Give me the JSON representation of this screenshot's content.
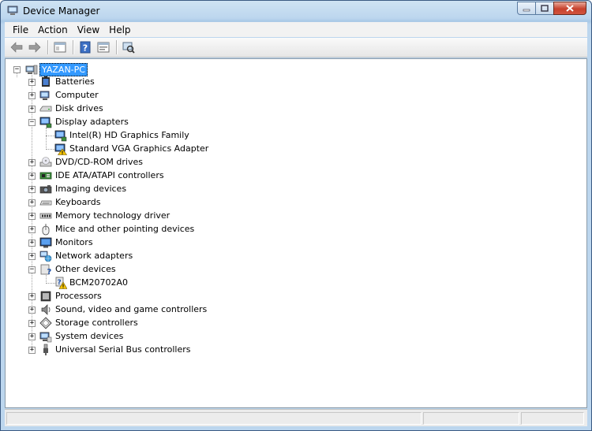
{
  "window": {
    "title": "Device Manager",
    "controls": [
      "minimize",
      "maximize",
      "close"
    ]
  },
  "menu": {
    "items": [
      "File",
      "Action",
      "View",
      "Help"
    ]
  },
  "toolbar": {
    "buttons": [
      "back-icon",
      "forward-icon",
      "show-hide-console-tree-icon",
      "help-icon",
      "properties-icon",
      "scan-hardware-icon"
    ]
  },
  "tree": {
    "root": "YAZAN-PC",
    "categories": [
      {
        "label": "Batteries",
        "icon": "battery-icon",
        "expanded": false
      },
      {
        "label": "Computer",
        "icon": "computer-icon",
        "expanded": false
      },
      {
        "label": "Disk drives",
        "icon": "disk-drive-icon",
        "expanded": false
      },
      {
        "label": "Display adapters",
        "icon": "display-adapter-icon",
        "expanded": true,
        "children": [
          {
            "label": "Intel(R) HD Graphics Family",
            "icon": "display-adapter-icon",
            "warning": false
          },
          {
            "label": "Standard VGA Graphics Adapter",
            "icon": "display-adapter-warning-icon",
            "warning": true
          }
        ]
      },
      {
        "label": "DVD/CD-ROM drives",
        "icon": "dvd-drive-icon",
        "expanded": false
      },
      {
        "label": "IDE ATA/ATAPI controllers",
        "icon": "ide-controller-icon",
        "expanded": false
      },
      {
        "label": "Imaging devices",
        "icon": "camera-icon",
        "expanded": false
      },
      {
        "label": "Keyboards",
        "icon": "keyboard-icon",
        "expanded": false
      },
      {
        "label": "Memory technology driver",
        "icon": "memory-icon",
        "expanded": false
      },
      {
        "label": "Mice and other pointing devices",
        "icon": "mouse-icon",
        "expanded": false
      },
      {
        "label": "Monitors",
        "icon": "monitor-icon",
        "expanded": false
      },
      {
        "label": "Network adapters",
        "icon": "network-icon",
        "expanded": false
      },
      {
        "label": "Other devices",
        "icon": "unknown-device-icon",
        "expanded": true,
        "children": [
          {
            "label": "BCM20702A0",
            "icon": "unknown-device-warning-icon",
            "warning": true
          }
        ]
      },
      {
        "label": "Processors",
        "icon": "processor-icon",
        "expanded": false
      },
      {
        "label": "Sound, video and game controllers",
        "icon": "speaker-icon",
        "expanded": false
      },
      {
        "label": "Storage controllers",
        "icon": "storage-controller-icon",
        "expanded": false
      },
      {
        "label": "System devices",
        "icon": "system-device-icon",
        "expanded": false
      },
      {
        "label": "Universal Serial Bus controllers",
        "icon": "usb-icon",
        "expanded": false
      }
    ]
  },
  "colors": {
    "selection": "#3399ff",
    "title_gradient_top": "#cfe3f3",
    "warning": "#f5c400"
  }
}
